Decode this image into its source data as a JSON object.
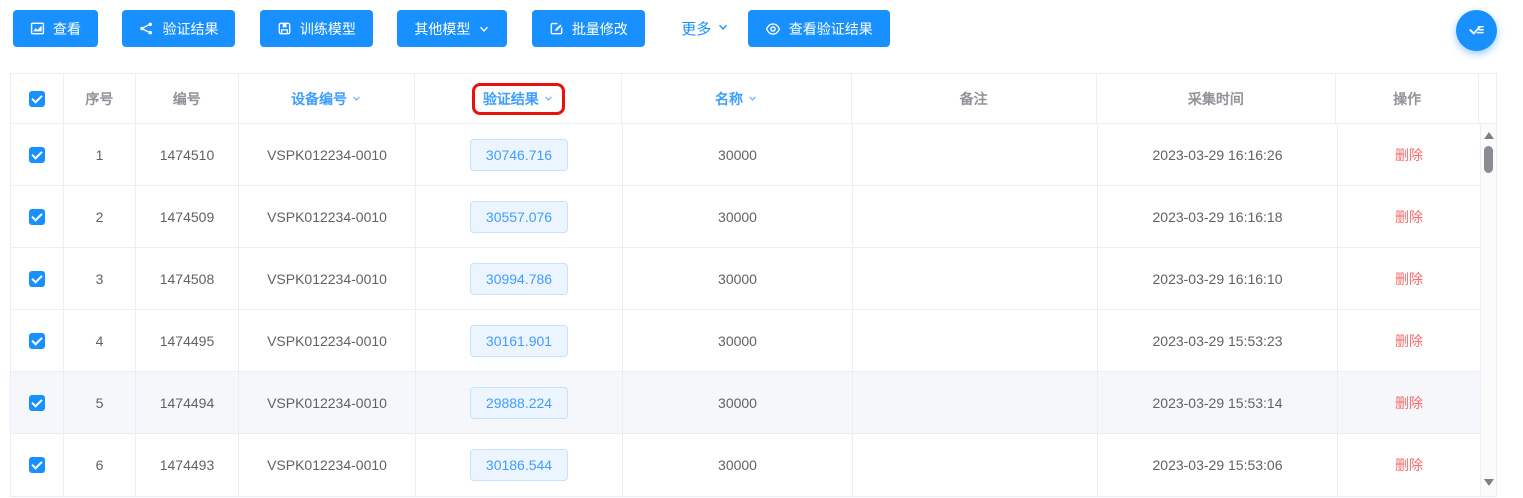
{
  "toolbar": {
    "buttons": [
      {
        "label": "查看",
        "icon": "chart-icon"
      },
      {
        "label": "验证结果",
        "icon": "share-icon"
      },
      {
        "label": "训练模型",
        "icon": "save-icon"
      },
      {
        "label": "其他模型",
        "icon": "chevron-down-icon",
        "dropdown": true
      },
      {
        "label": "批量修改",
        "icon": "edit-icon"
      }
    ],
    "more": {
      "label": "更多",
      "icon": "chevron-down-icon"
    },
    "view_results": {
      "label": "查看验证结果",
      "icon": "eye-icon"
    }
  },
  "fab": {
    "icon": "checklist-icon"
  },
  "table": {
    "headers": [
      {
        "label": "",
        "type": "select-all-checkbox",
        "checked": true
      },
      {
        "label": "序号"
      },
      {
        "label": "编号"
      },
      {
        "label": "设备编号",
        "sortable": true
      },
      {
        "label": "验证结果",
        "sortable": true,
        "highlighted_with_red_box": true
      },
      {
        "label": "名称",
        "sortable": true
      },
      {
        "label": "备注"
      },
      {
        "label": "采集时间"
      },
      {
        "label": "操作"
      }
    ],
    "rows": [
      {
        "index": "1",
        "code": "1474510",
        "device_id": "VSPK012234-0010",
        "result": "30746.716",
        "name": "30000",
        "remark": "",
        "collect_time": "2023-03-29 16:16:26",
        "action_label": "删除",
        "checked": true,
        "highlighted": false
      },
      {
        "index": "2",
        "code": "1474509",
        "device_id": "VSPK012234-0010",
        "result": "30557.076",
        "name": "30000",
        "remark": "",
        "collect_time": "2023-03-29 16:16:18",
        "action_label": "删除",
        "checked": true,
        "highlighted": false
      },
      {
        "index": "3",
        "code": "1474508",
        "device_id": "VSPK012234-0010",
        "result": "30994.786",
        "name": "30000",
        "remark": "",
        "collect_time": "2023-03-29 16:16:10",
        "action_label": "删除",
        "checked": true,
        "highlighted": false
      },
      {
        "index": "4",
        "code": "1474495",
        "device_id": "VSPK012234-0010",
        "result": "30161.901",
        "name": "30000",
        "remark": "",
        "collect_time": "2023-03-29 15:53:23",
        "action_label": "删除",
        "checked": true,
        "highlighted": false
      },
      {
        "index": "5",
        "code": "1474494",
        "device_id": "VSPK012234-0010",
        "result": "29888.224",
        "name": "30000",
        "remark": "",
        "collect_time": "2023-03-29 15:53:14",
        "action_label": "删除",
        "checked": true,
        "highlighted": true
      },
      {
        "index": "6",
        "code": "1474493",
        "device_id": "VSPK012234-0010",
        "result": "30186.544",
        "name": "30000",
        "remark": "",
        "collect_time": "2023-03-29 15:53:06",
        "action_label": "删除",
        "checked": true,
        "highlighted": false
      }
    ]
  },
  "colors": {
    "primary_button": "#1890ff",
    "sorted_header_link": "#409eff",
    "danger_link": "#f56c6c",
    "badge_bg": "#ecf5ff",
    "badge_border": "#c6e2ff",
    "table_border": "#ebeef5",
    "header_text": "#909399",
    "cell_text": "#606266",
    "hover_row_bg": "#f5f7fa",
    "red_highlight_box": "#e8110d"
  }
}
